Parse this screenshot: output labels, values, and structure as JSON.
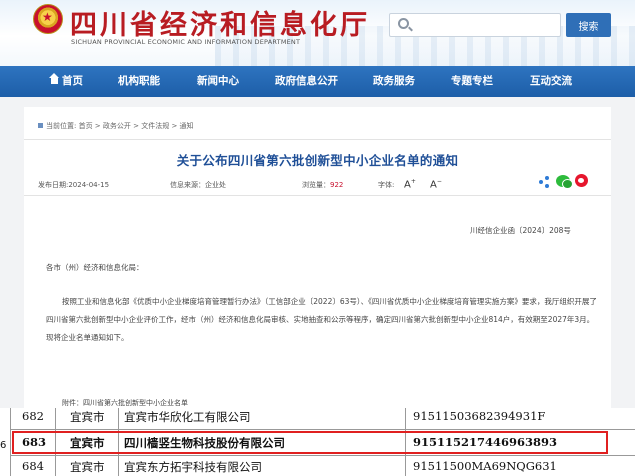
{
  "header": {
    "site_title": "四川省经济和信息化厅",
    "site_subtitle": "SICHUAN PROVINCIAL ECONOMIC AND INFORMATION DEPARTMENT",
    "search_placeholder": "",
    "search_button": "搜索"
  },
  "nav": {
    "items": [
      "首页",
      "机构职能",
      "新闻中心",
      "政府信息公开",
      "政务服务",
      "专题专栏",
      "互动交流"
    ]
  },
  "breadcrumb": "当前位置: 首页 > 政务公开 > 文件法规 > 通知",
  "article": {
    "title": "关于公布四川省第六批创新型中小企业名单的通知",
    "publish_date": "发布日期:2024-04-15",
    "source_label": "信息来源：企业处",
    "views_label": "浏览量：",
    "views": "922",
    "font_label": "字体:",
    "font_big": "A",
    "font_small": "A",
    "doc_number": "川经信企业函〔2024〕208号",
    "addressee": "各市（州）经济和信息化局：",
    "body": "按照工业和信息化部《优质中小企业梯度培育管理暂行办法》（工信部企业〔2022〕63号）、《四川省优质中小企业梯度培育管理实施方案》要求，我厅组织开展了四川省第六批创新型中小企业评价工作，经市（州）经济和信息化局审核、实地抽查和公示等程序，确定四川省第六批创新型中小企业814户，有效期至2027年3月。现将企业名单通知如下。",
    "attachment": "附件：四川省第六批创新型中小企业名单"
  },
  "table": {
    "rows": [
      {
        "no": "682",
        "city": "宜宾市",
        "company": "宜宾市华欣化工有限公司",
        "code": "91511503682394931F"
      },
      {
        "no": "683",
        "city": "宜宾市",
        "company": "四川樯竖生物科技股份有限公司",
        "code": "915115217446963893"
      },
      {
        "no": "684",
        "city": "宜宾市",
        "company": "宜宾东方拓宇科技有限公司",
        "code": "91511500MA69NQG631"
      }
    ],
    "edge_char": "6"
  },
  "colors": {
    "nav_blue": "#1d5ea8",
    "title_red": "#b81c22",
    "highlight_red": "#e02020"
  }
}
